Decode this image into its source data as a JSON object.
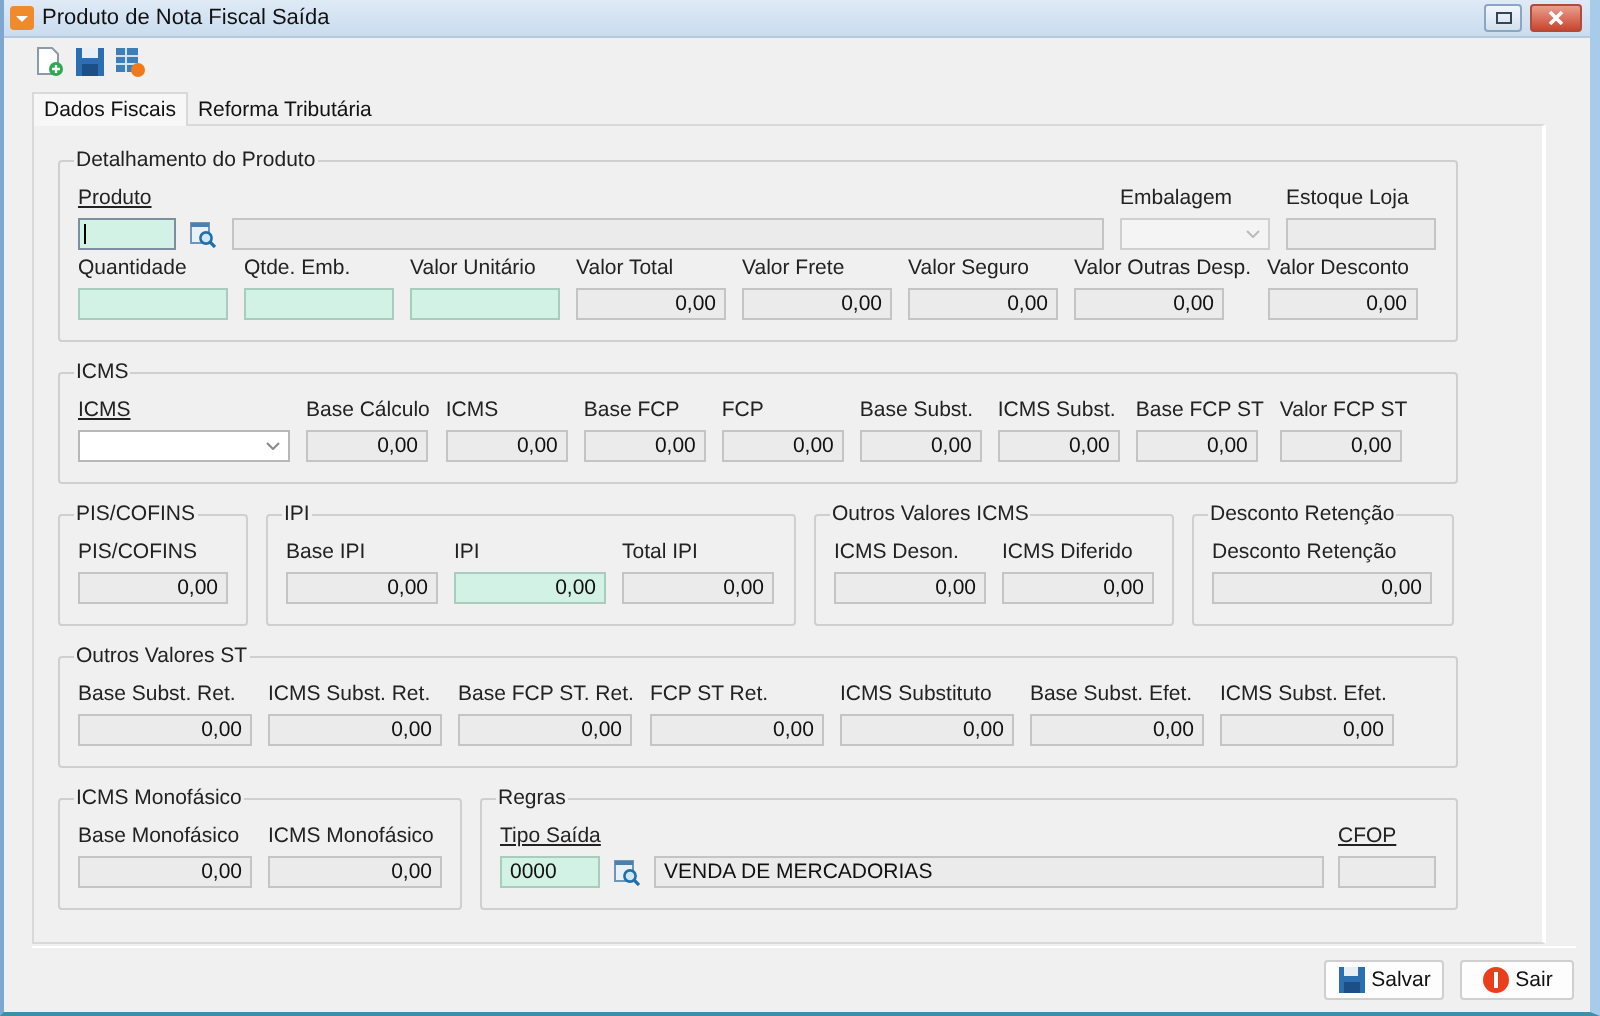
{
  "window": {
    "title": "Produto de Nota Fiscal Saída"
  },
  "tabs": [
    {
      "label": "Dados Fiscais",
      "selected": true
    },
    {
      "label": "Reforma Tributária",
      "selected": false
    }
  ],
  "section_rows": [
    [
      {
        "title": "Detalhamento do Produto",
        "rows": [
          {
            "fields": [
              {
                "kind": "lookup",
                "label": "Produto",
                "link": true,
                "editable": true,
                "focused": true
              },
              {
                "kind": "text",
                "editable": false,
                "focused": false
              },
              {
                "kind": "combo",
                "label": "Embalagem",
                "link": false,
                "editable": false,
                "focused": false
              },
              {
                "kind": "text",
                "label": "Estoque Loja",
                "link": false,
                "editable": false,
                "focused": false
              }
            ]
          },
          {
            "fields": [
              {
                "kind": "number",
                "label": "Quantidade",
                "link": false,
                "editable": true,
                "focused": false
              },
              {
                "kind": "number",
                "label": "Qtde. Emb.",
                "link": false,
                "editable": true,
                "focused": false
              },
              {
                "kind": "number",
                "label": "Valor Unitário",
                "link": false,
                "editable": true,
                "focused": false
              },
              {
                "kind": "number",
                "label": "Valor Total",
                "link": false,
                "editable": false,
                "focused": false,
                "value": "0,00"
              },
              {
                "kind": "number",
                "label": "Valor Frete",
                "link": false,
                "editable": false,
                "focused": false,
                "value": "0,00"
              },
              {
                "kind": "number",
                "label": "Valor Seguro",
                "link": false,
                "editable": false,
                "focused": false,
                "value": "0,00"
              },
              {
                "kind": "number",
                "label": "Valor Outras Desp.",
                "link": false,
                "editable": false,
                "focused": false,
                "value": "0,00"
              },
              {
                "kind": "number",
                "label": "Valor Desconto",
                "link": false,
                "editable": false,
                "focused": false,
                "value": "0,00"
              }
            ]
          }
        ]
      }
    ],
    [
      {
        "title": "ICMS",
        "rows": [
          [
            {
              "kind": "combo",
              "label": "ICMS",
              "link": true,
              "editable": true,
              "focused": false
            },
            {
              "kind": "number",
              "label": "Base Cálculo",
              "link": false,
              "editable": false,
              "focused": false,
              "value": "0,00"
            },
            {
              "kind": "number",
              "label": "ICMS",
              "link": false,
              "editable": false,
              "focused": false,
              "value": "0,00"
            },
            {
              "kind": "number",
              "label": "Base FCP",
              "link": false,
              "editable": false,
              "focused": false,
              "value": "0,00"
            },
            {
              "kind": "number",
              "label": "FCP",
              "link": false,
              "editable": false,
              "focused": false,
              "value": "0,00"
            },
            {
              "kind": "number",
              "label": "Base Subst.",
              "link": false,
              "editable": false,
              "focused": false,
              "value": "0,00"
            },
            {
              "kind": "number",
              "label": "ICMS Subst.",
              "link": false,
              "editable": false,
              "focused": false,
              "value": "0,00"
            },
            {
              "kind": "number",
              "label": "Base FCP ST",
              "link": false,
              "editable": false,
              "focused": false,
              "value": "0,00"
            },
            {
              "kind": "number",
              "label": "Valor FCP ST",
              "link": false,
              "editable": false,
              "focused": false,
              "value": "0,00"
            }
          ]
        ]
      }
    ],
    [
      {
        "title": "PIS/COFINS",
        "rows": [
          [
            {
              "kind": "number",
              "label": "PIS/COFINS",
              "link": false,
              "editable": false,
              "focused": false,
              "value": "0,00"
            }
          ]
        ]
      },
      {
        "title": "IPI",
        "rows": [
          [
            {
              "kind": "number",
              "label": "Base IPI",
              "link": false,
              "editable": false,
              "focused": false,
              "value": "0,00"
            },
            {
              "kind": "number",
              "label": "IPI",
              "link": false,
              "editable": true,
              "focused": false,
              "value": "0,00"
            },
            {
              "kind": "number",
              "label": "Total IPI",
              "link": false,
              "editable": false,
              "focused": false,
              "value": "0,00"
            }
          ]
        ]
      },
      {
        "title": "Outros Valores ICMS",
        "rows": [
          [
            {
              "kind": "number",
              "label": "ICMS Deson.",
              "link": false,
              "editable": false,
              "focused": false,
              "value": "0,00"
            },
            {
              "kind": "number",
              "label": "ICMS Diferido",
              "link": false,
              "editable": false,
              "focused": false,
              "value": "0,00"
            }
          ]
        ]
      },
      {
        "title": "Desconto Retenção",
        "rows": [
          [
            {
              "kind": "number",
              "label": "Desconto Retenção",
              "link": false,
              "editable": false,
              "focused": false,
              "value": "0,00"
            }
          ]
        ]
      }
    ],
    [
      {
        "title": "Outros Valores ST",
        "rows": [
          [
            {
              "kind": "number",
              "label": "Base Subst. Ret.",
              "link": false,
              "editable": false,
              "focused": false,
              "value": "0,00"
            },
            {
              "kind": "number",
              "label": "ICMS Subst. Ret.",
              "link": false,
              "editable": false,
              "focused": false,
              "value": "0,00"
            },
            {
              "kind": "number",
              "label": "Base FCP ST. Ret.",
              "link": false,
              "editable": false,
              "focused": false,
              "value": "0,00"
            },
            {
              "kind": "number",
              "label": "FCP ST Ret.",
              "link": false,
              "editable": false,
              "focused": false,
              "value": "0,00"
            },
            {
              "kind": "number",
              "label": "ICMS Substituto",
              "link": false,
              "editable": false,
              "focused": false,
              "value": "0,00"
            },
            {
              "kind": "number",
              "label": "Base Subst. Efet.",
              "link": false,
              "editable": false,
              "focused": false,
              "value": "0,00"
            },
            {
              "kind": "number",
              "label": "ICMS Subst. Efet.",
              "link": false,
              "editable": false,
              "focused": false,
              "value": "0,00"
            }
          ]
        ]
      }
    ],
    [
      {
        "title": "ICMS Monofásico",
        "rows": [
          [
            {
              "kind": "number",
              "label": "Base Monofásico",
              "link": false,
              "editable": false,
              "focused": false,
              "value": "0,00"
            },
            {
              "kind": "number",
              "label": "ICMS Monofásico",
              "link": false,
              "editable": false,
              "focused": false,
              "value": "0,00"
            }
          ]
        ]
      },
      {
        "title": "Regras",
        "rows": [
          [
            {
              "kind": "lookup",
              "label": "Tipo Saída",
              "link": true,
              "editable": true,
              "focused": false,
              "value": "0000"
            },
            {
              "kind": "text",
              "editable": false,
              "focused": false,
              "value": "VENDA DE MERCADORIAS"
            },
            {
              "kind": "text",
              "label": "CFOP",
              "link": true,
              "editable": false,
              "focused": false
            }
          ]
        ]
      }
    ]
  ],
  "buttons": [
    {
      "kind": "save",
      "label": "Salvar"
    },
    {
      "kind": "exit",
      "label": "Sair"
    }
  ]
}
